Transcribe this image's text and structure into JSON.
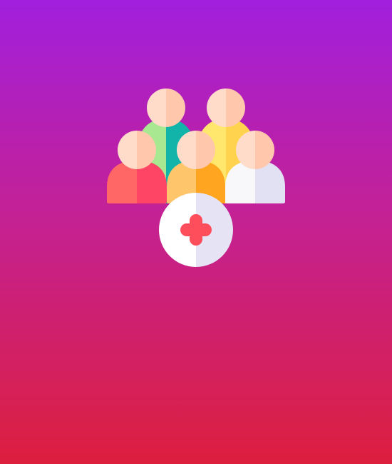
{
  "screen": {
    "background": {
      "top": "#A11FDD",
      "middle": "#C32196",
      "bottom": "#DD1F3E"
    },
    "illustration": {
      "icon_name": "group-medical-care-icon",
      "figures": [
        {
          "name": "back-left-person",
          "colors": [
            "#A8E890",
            "#12B3A8"
          ],
          "skin": [
            "#FFDCC9",
            "#FFC8AC"
          ]
        },
        {
          "name": "back-right-person",
          "colors": [
            "#FFE66C",
            "#FFD34D"
          ],
          "skin": [
            "#FFDCC9",
            "#FFC8AC"
          ]
        },
        {
          "name": "front-left-person",
          "colors": [
            "#FF6767",
            "#FF4566"
          ],
          "skin": [
            "#FFDCC9",
            "#FFC8AC"
          ]
        },
        {
          "name": "front-center-person",
          "colors": [
            "#FFC56A",
            "#FFA51F"
          ],
          "skin": [
            "#FFDCC9",
            "#FFC8AC"
          ]
        },
        {
          "name": "front-right-person",
          "colors": [
            "#F8F8FB",
            "#E2E1F4"
          ],
          "skin": [
            "#FFDCC9",
            "#FFC8AC"
          ]
        }
      ],
      "badge": {
        "colors": [
          "#FFFFFF",
          "#E5E3F4"
        ],
        "cross": "#FF4E5B"
      }
    }
  }
}
